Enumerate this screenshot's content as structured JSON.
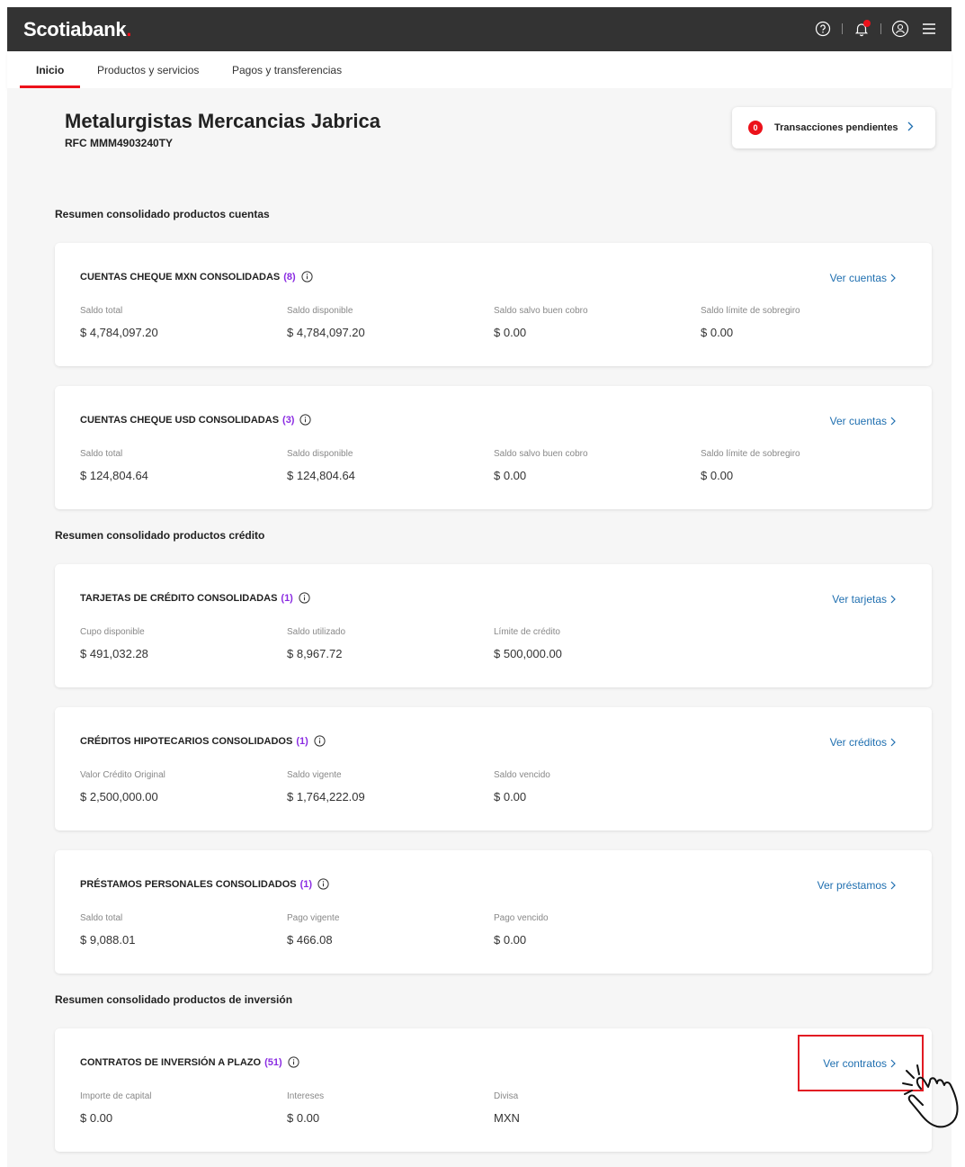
{
  "header": {
    "logo_text": "Scotiabank",
    "logo_dot": ".",
    "icons": [
      "help-icon",
      "bell-icon",
      "user-icon",
      "menu-icon"
    ],
    "accent_color": "#ec111a",
    "bar_color": "#333333"
  },
  "nav": {
    "tabs": [
      {
        "label": "Inicio",
        "active": true
      },
      {
        "label": "Productos y servicios",
        "active": false
      },
      {
        "label": "Pagos y transferencias",
        "active": false
      }
    ]
  },
  "company": {
    "name": "Metalurgistas Mercancias Jabrica",
    "rfc": "RFC MMM4903240TY"
  },
  "pending": {
    "count": "0",
    "label": "Transacciones pendientes"
  },
  "sections": [
    "Resumen consolidado productos cuentas",
    "Resumen consolidado productos crédito",
    "Resumen consolidado productos de inversión"
  ],
  "cards": [
    {
      "title": "CUENTAS CHEQUE MXN CONSOLIDADAS",
      "count": "(8)",
      "link": "Ver cuentas",
      "metrics": [
        {
          "label": "Saldo total",
          "value": "$ 4,784,097.20"
        },
        {
          "label": "Saldo disponible",
          "value": "$ 4,784,097.20"
        },
        {
          "label": "Saldo salvo buen cobro",
          "value": "$ 0.00"
        },
        {
          "label": "Saldo límite de sobregiro",
          "value": "$ 0.00"
        }
      ]
    },
    {
      "title": "CUENTAS CHEQUE USD CONSOLIDADAS",
      "count": "(3)",
      "link": "Ver cuentas",
      "metrics": [
        {
          "label": "Saldo total",
          "value": "$ 124,804.64"
        },
        {
          "label": "Saldo disponible",
          "value": "$ 124,804.64"
        },
        {
          "label": "Saldo salvo buen cobro",
          "value": "$ 0.00"
        },
        {
          "label": "Saldo límite de sobregiro",
          "value": "$ 0.00"
        }
      ]
    },
    {
      "title": "TARJETAS DE CRÉDITO CONSOLIDADAS",
      "count": "(1)",
      "link": "Ver tarjetas",
      "metrics": [
        {
          "label": "Cupo disponible",
          "value": "$ 491,032.28"
        },
        {
          "label": "Saldo utilizado",
          "value": "$ 8,967.72"
        },
        {
          "label": "Límite de crédito",
          "value": "$ 500,000.00"
        }
      ]
    },
    {
      "title": "CRÉDITOS HIPOTECARIOS CONSOLIDADOS",
      "count": "(1)",
      "link": "Ver créditos",
      "metrics": [
        {
          "label": "Valor Crédito Original",
          "value": "$ 2,500,000.00"
        },
        {
          "label": "Saldo vigente",
          "value": "$ 1,764,222.09"
        },
        {
          "label": "Saldo vencido",
          "value": "$ 0.00"
        }
      ]
    },
    {
      "title": "PRÉSTAMOS PERSONALES CONSOLIDADOS",
      "count": "(1)",
      "link": "Ver préstamos",
      "metrics": [
        {
          "label": "Saldo total",
          "value": "$ 9,088.01"
        },
        {
          "label": "Pago vigente",
          "value": "$ 466.08"
        },
        {
          "label": "Pago vencido",
          "value": "$ 0.00"
        }
      ]
    },
    {
      "title": "CONTRATOS DE INVERSIÓN A PLAZO",
      "count": "(51)",
      "link": "Ver contratos",
      "metrics": [
        {
          "label": "Importe de capital",
          "value": "$ 0.00"
        },
        {
          "label": "Intereses",
          "value": "$ 0.00"
        },
        {
          "label": "Divisa",
          "value": "MXN"
        }
      ]
    }
  ]
}
